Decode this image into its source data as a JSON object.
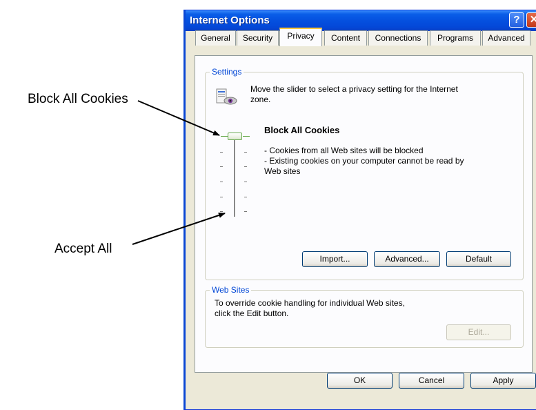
{
  "annotations": {
    "block_all": "Block All Cookies",
    "accept_all": "Accept All"
  },
  "window": {
    "title": "Internet Options",
    "help_glyph": "?",
    "close_glyph": "✕"
  },
  "tabs": [
    "General",
    "Security",
    "Privacy",
    "Content",
    "Connections",
    "Programs",
    "Advanced"
  ],
  "active_tab": "Privacy",
  "settings": {
    "legend": "Settings",
    "intro_line1": "Move the slider to select a privacy setting for the Internet",
    "intro_line2": "zone.",
    "level_title": "Block All Cookies",
    "desc_line1": "- Cookies from all Web sites will be blocked",
    "desc_line2": "- Existing cookies on your computer cannot be read by",
    "desc_line3": "Web sites",
    "slider_level": "Block All Cookies",
    "import_label": "Import...",
    "advanced_label": "Advanced...",
    "default_label": "Default"
  },
  "web_sites": {
    "legend": "Web Sites",
    "line1": "To override cookie handling for individual Web sites,",
    "line2": "click the Edit button.",
    "edit_label": "Edit..."
  },
  "footer": {
    "ok_label": "OK",
    "cancel_label": "Cancel",
    "apply_label": "Apply"
  },
  "colors": {
    "titlebar": "#0550df",
    "legend": "#0046d5",
    "slider_thumb": "#63a74a",
    "active_tab_highlight": "#ffc83c"
  },
  "icons": [
    "help-icon",
    "close-icon",
    "privacy-icon"
  ]
}
